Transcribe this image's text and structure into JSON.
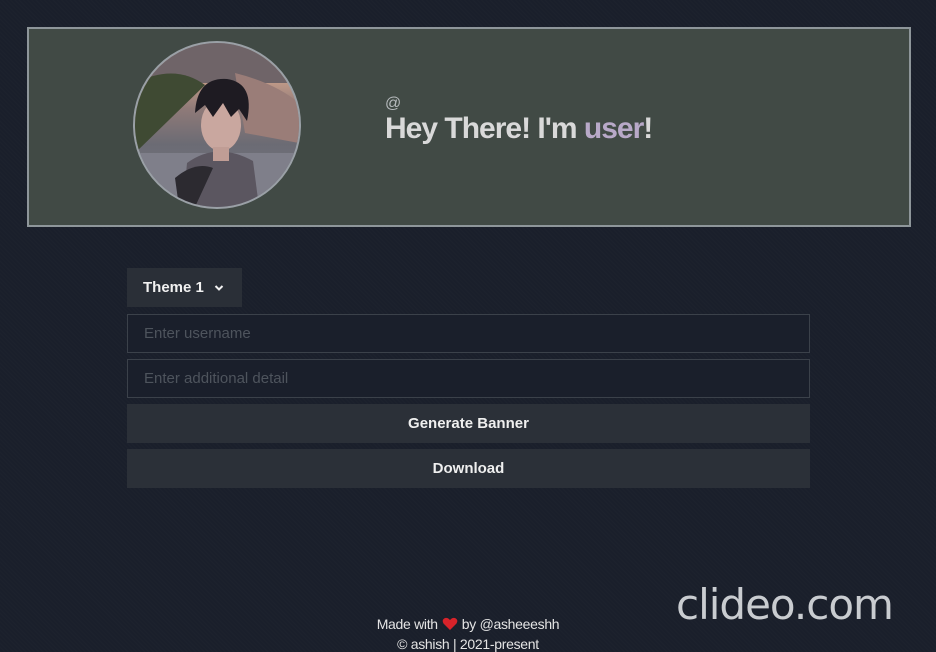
{
  "banner": {
    "at_sign": "@",
    "greeting": "Hey There! I'm",
    "username": "user",
    "exclaim": "!"
  },
  "form": {
    "theme_selected": "Theme 1",
    "username_placeholder": "Enter username",
    "username_value": "",
    "detail_placeholder": "Enter additional detail",
    "detail_value": "",
    "generate_label": "Generate Banner",
    "download_label": "Download"
  },
  "footer": {
    "made_with": "Made with",
    "by": "by @asheeeshh",
    "copyright": "© ashish | 2021-present"
  },
  "watermark": "clideo.com",
  "colors": {
    "background": "#1a1f2b",
    "banner_bg": "#414a45",
    "username_accent": "#b8a9c8",
    "heart": "#d8232a"
  }
}
